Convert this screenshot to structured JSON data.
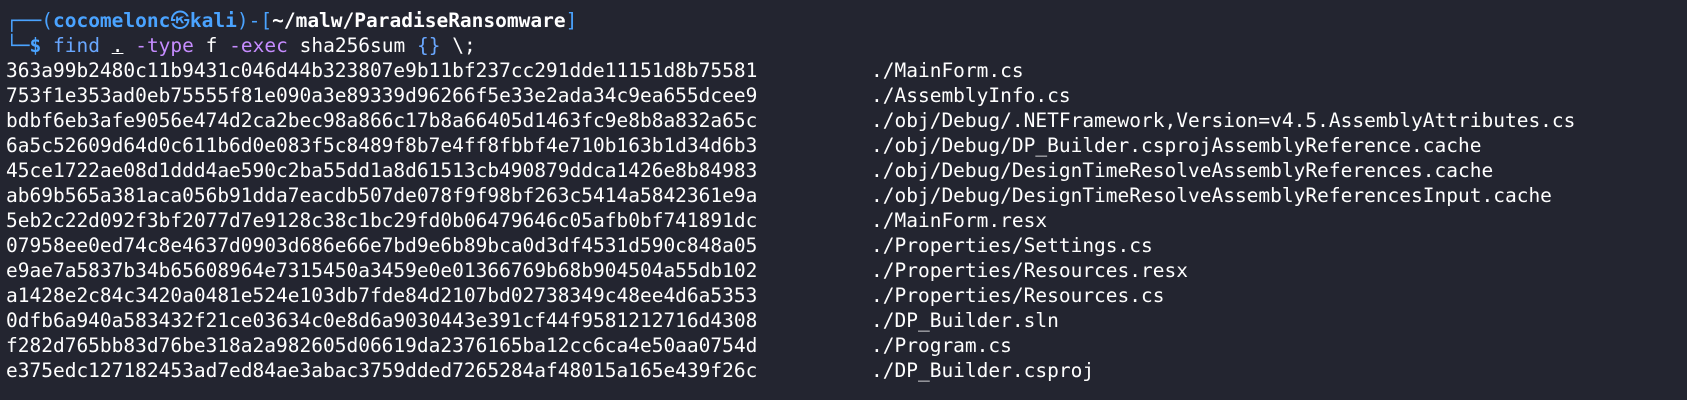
{
  "prompt": {
    "box_top_left": "┌──(",
    "user": "cocomelonc",
    "skull": "㉿",
    "host": "kali",
    "mid": ")-[",
    "path": "~/malw/ParadiseRansomware",
    "end": "]",
    "box_bottom_left": "└─",
    "dollar": "$"
  },
  "command": {
    "name": "find",
    "dot": ".",
    "flag_type": "-type",
    "type_val": "f",
    "flag_exec": "-exec",
    "exec_cmd": "sha256sum",
    "braces": "{}",
    "terminator": "\\;"
  },
  "rows": [
    {
      "hash": "363a99b2480c11b9431c046d44b323807e9b11bf237cc291dde11151d8b75581",
      "file": "./MainForm.cs"
    },
    {
      "hash": "753f1e353ad0eb75555f81e090a3e89339d96266f5e33e2ada34c9ea655dcee9",
      "file": "./AssemblyInfo.cs"
    },
    {
      "hash": "bdbf6eb3afe9056e474d2ca2bec98a866c17b8a66405d1463fc9e8b8a832a65c",
      "file": "./obj/Debug/.NETFramework,Version=v4.5.AssemblyAttributes.cs"
    },
    {
      "hash": "6a5c52609d64d0c611b6d0e083f5c8489f8b7e4ff8fbbf4e710b163b1d34d6b3",
      "file": "./obj/Debug/DP_Builder.csprojAssemblyReference.cache"
    },
    {
      "hash": "45ce1722ae08d1ddd4ae590c2ba55dd1a8d61513cb490879ddca1426e8b84983",
      "file": "./obj/Debug/DesignTimeResolveAssemblyReferences.cache"
    },
    {
      "hash": "ab69b565a381aca056b91dda7eacdb507de078f9f98bf263c5414a5842361e9a",
      "file": "./obj/Debug/DesignTimeResolveAssemblyReferencesInput.cache"
    },
    {
      "hash": "5eb2c22d092f3bf2077d7e9128c38c1bc29fd0b06479646c05afb0bf741891dc",
      "file": "./MainForm.resx"
    },
    {
      "hash": "07958ee0ed74c8e4637d0903d686e66e7bd9e6b89bca0d3df4531d590c848a05",
      "file": "./Properties/Settings.cs"
    },
    {
      "hash": "e9ae7a5837b34b65608964e7315450a3459e0e01366769b68b904504a55db102",
      "file": "./Properties/Resources.resx"
    },
    {
      "hash": "a1428e2c84c3420a0481e524e103db7fde84d2107bd02738349c48ee4d6a5353",
      "file": "./Properties/Resources.cs"
    },
    {
      "hash": "0dfb6a940a583432f21ce03634c0e8d6a9030443e391cf44f9581212716d4308",
      "file": "./DP_Builder.sln"
    },
    {
      "hash": "f282d765bb83d76be318a2a982605d06619da2376165ba12cc6ca4e50aa0754d",
      "file": "./Program.cs"
    },
    {
      "hash": "e375edc127182453ad7ed84ae3abac3759dded7265284af48015a165e439f26c",
      "file": "./DP_Builder.csproj"
    }
  ],
  "colors": {
    "background": "#232530",
    "prompt_blue": "#4aa3ff",
    "command_blue": "#69a7ff",
    "flag_purple": "#c68cff",
    "text": "#ffffff"
  }
}
